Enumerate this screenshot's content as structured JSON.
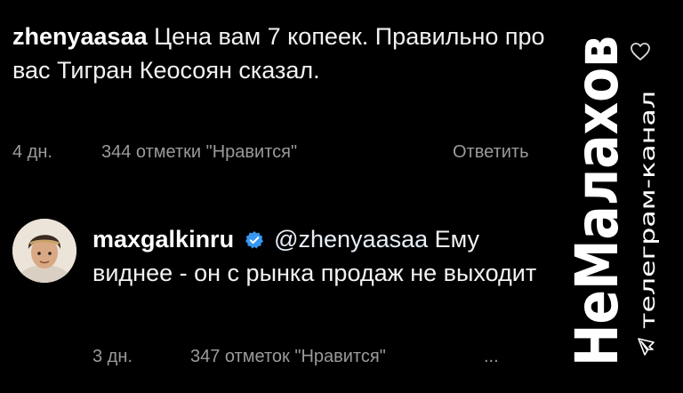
{
  "comment1": {
    "username": "zhenyaasaa",
    "text": "Цена вам 7 копеек. Правильно про вас Тигран Кеосоян сказал.",
    "time": "4 дн.",
    "likes": "344 отметки \"Нравится\"",
    "reply_label": "Ответить"
  },
  "comment2": {
    "username": "maxgalkinru",
    "mention": "@zhenyaasaa",
    "text": "Ему виднее - он с рынка продаж не выходит",
    "time": "3 дн.",
    "likes": "347 отметок \"Нравится\"",
    "more_label": "..."
  },
  "watermark": {
    "title": "НеМалахов",
    "subtitle": "телеграм-канал"
  },
  "icons": {
    "like": "heart-icon",
    "verified": "verified-badge-icon",
    "telegram": "telegram-icon"
  },
  "colors": {
    "background": "#000000",
    "meta_text": "#9a9a9a",
    "verified_blue": "#3897f0"
  }
}
